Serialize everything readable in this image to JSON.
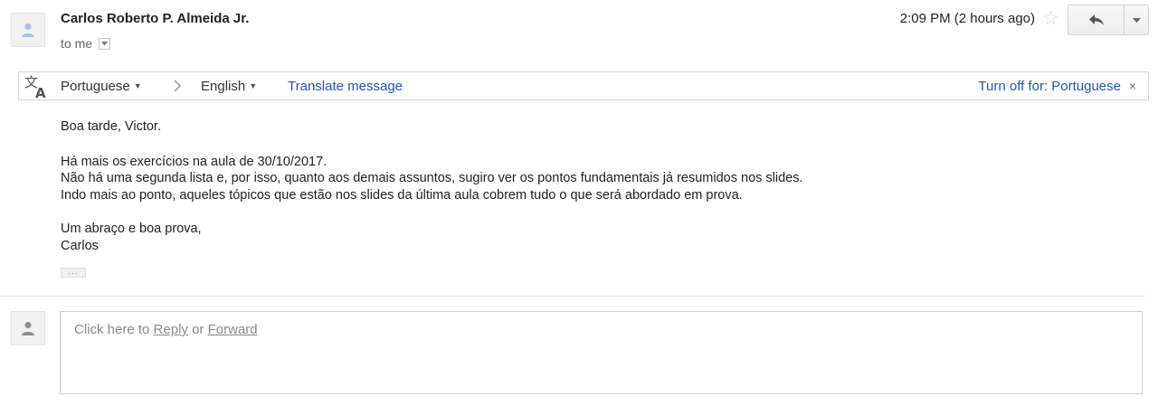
{
  "header": {
    "sender_name": "Carlos Roberto P. Almeida Jr.",
    "recipient": "to me",
    "timestamp": "2:09 PM (2 hours ago)"
  },
  "icons": {
    "avatar": "person-icon",
    "recipient_dropdown": "chevron-down-icon",
    "star": "star-icon",
    "reply": "reply-icon",
    "more": "chevron-down-icon",
    "translate": "translate-icon",
    "language_arrow": "chevron-right-icon",
    "close": "close-icon"
  },
  "translate_bar": {
    "source_language": "Portuguese",
    "target_language": "English",
    "translate_link": "Translate message",
    "turn_off_link": "Turn off for: Portuguese",
    "close_glyph": "×"
  },
  "message": {
    "greeting": "Boa tarde, Victor.",
    "lines": [
      "Há mais os exercícios na aula de 30/10/2017.",
      "Não há uma segunda lista e, por isso, quanto aos demais assuntos, sugiro ver os pontos fundamentais já resumidos nos slides.",
      "Indo mais ao ponto, aqueles tópicos que estão nos slides da última aula cobrem tudo o que será abordado em prova."
    ],
    "closing": "Um abraço e boa prova,",
    "signature": "Carlos",
    "trimmed_content_glyph": "···"
  },
  "reply_area": {
    "prefix": "Click here to ",
    "reply_link": "Reply",
    "middle": " or ",
    "forward_link": "Forward"
  },
  "colors": {
    "link": "#2255bb",
    "text": "#222222",
    "muted": "#8a8a8a",
    "border": "#d6d6d6"
  }
}
